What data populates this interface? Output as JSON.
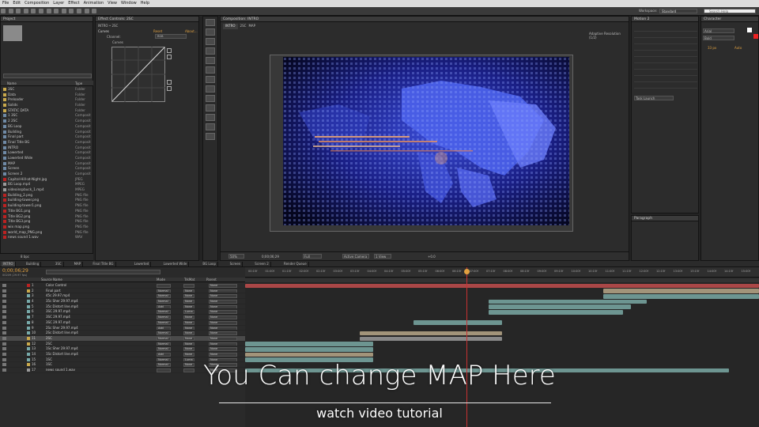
{
  "menu": [
    "File",
    "Edit",
    "Composition",
    "Layer",
    "Effect",
    "Animation",
    "View",
    "Window",
    "Help"
  ],
  "toolbar": {
    "workspace_label": "Workspace:",
    "workspace_value": "Standard",
    "search_placeholder": "Search Help"
  },
  "project": {
    "tab": "Project",
    "col_name": "Name",
    "col_type": "Type",
    "items": [
      {
        "name": "3SC",
        "type": "Folder",
        "kind": "folder"
      },
      {
        "name": "Data",
        "type": "Folder",
        "kind": "folder"
      },
      {
        "name": "Preloader",
        "type": "Folder",
        "kind": "folder"
      },
      {
        "name": "Solids",
        "type": "Folder",
        "kind": "folder"
      },
      {
        "name": "STATIC DATA",
        "type": "Folder",
        "kind": "folder"
      },
      {
        "name": "1 3SC",
        "type": "Composit",
        "kind": "comp"
      },
      {
        "name": "2 2SC",
        "type": "Composit",
        "kind": "comp"
      },
      {
        "name": "BG Loop",
        "type": "Composit",
        "kind": "comp"
      },
      {
        "name": "Building",
        "type": "Composit",
        "kind": "comp"
      },
      {
        "name": "Final part",
        "type": "Composit",
        "kind": "comp"
      },
      {
        "name": "Final Title BG",
        "type": "Composit",
        "kind": "comp"
      },
      {
        "name": "INTRO",
        "type": "Composit",
        "kind": "comp"
      },
      {
        "name": "Lowerted",
        "type": "Composit",
        "kind": "comp"
      },
      {
        "name": "Lowerted Wide",
        "type": "Composit",
        "kind": "comp"
      },
      {
        "name": "MAP",
        "type": "Composit",
        "kind": "comp"
      },
      {
        "name": "Screen",
        "type": "Composit",
        "kind": "comp"
      },
      {
        "name": "Screen 2",
        "type": "Composit",
        "kind": "comp"
      },
      {
        "name": "Capitol-Hill-at-Night.jpg",
        "type": "JPEG",
        "kind": "file"
      },
      {
        "name": "BG Loop.mp4",
        "type": "MPEG",
        "kind": "mp4"
      },
      {
        "name": "videoinspbuck_1.mp4",
        "type": "MPEG",
        "kind": "mp4"
      },
      {
        "name": "Building_2.png",
        "type": "PNG file",
        "kind": "file"
      },
      {
        "name": "building-tower.png",
        "type": "PNG file",
        "kind": "file"
      },
      {
        "name": "building-tower1.png",
        "type": "PNG file",
        "kind": "file"
      },
      {
        "name": "Title BG1.png",
        "type": "PNG file",
        "kind": "file"
      },
      {
        "name": "Title BG2.png",
        "type": "PNG file",
        "kind": "file"
      },
      {
        "name": "Title BG3.png",
        "type": "PNG file",
        "kind": "file"
      },
      {
        "name": "wix map.png",
        "type": "PNG file",
        "kind": "file"
      },
      {
        "name": "world_map_PNG.png",
        "type": "PNG file",
        "kind": "file"
      },
      {
        "name": "news sound 1.wav",
        "type": "WAV",
        "kind": "file"
      }
    ],
    "footer": "8 bpc"
  },
  "effect_controls": {
    "tab": "Effect Controls: 2SC",
    "breadcrumb": "INTRO • 2SC",
    "effect_name": "Curves",
    "reset": "Reset",
    "about": "About...",
    "channel_label": "Channel:",
    "channel_value": "RGB",
    "curves_label": "Curves"
  },
  "composition": {
    "tab": "Composition: INTRO",
    "crumbs": [
      "INTRO",
      "2SC",
      "MAP"
    ],
    "renderer": "Adaptive Resolution (1/2)",
    "zoom": "50%",
    "timecode": "0;00;06;29",
    "resolution": "Full",
    "camera": "Active Camera",
    "views": "1 View",
    "offset": "+0.0"
  },
  "right_panels": {
    "info_tab": "Info",
    "audio_tab": "Audio",
    "motion_tab": "Motion 2",
    "preset_tab": "Effects & Presets",
    "character_tab": "Character",
    "font": "Arial",
    "style": "Bold",
    "font_size": "33 px",
    "tracking": "Auto",
    "paragraph_tab": "Paragraph",
    "task_label": "Task Launch"
  },
  "timeline": {
    "tabs": [
      "INTRO",
      "Building",
      "3SC",
      "MAP",
      "Final Title BG",
      "Lowerted",
      "Lowerted Wide",
      "BG Loop",
      "Screen",
      "Screen 2",
      "Render Queue"
    ],
    "timecode": "0;00;06;29",
    "fps": "00209 (29.97 fps)",
    "col_source": "Source Name",
    "col_mode": "Mode",
    "col_trkmat": "TrkMat",
    "col_parent": "Parent",
    "ruler": [
      "00:15f",
      "01:00f",
      "01:15f",
      "02:00f",
      "02:15f",
      "03:00f",
      "03:15f",
      "04:00f",
      "04:15f",
      "05:00f",
      "05:15f",
      "06:00f",
      "06:15f",
      "07:00f",
      "07:15f",
      "08:00f",
      "08:15f",
      "09:00f",
      "09:15f",
      "10:00f",
      "10:15f",
      "11:00f",
      "11:15f",
      "12:00f",
      "12:15f",
      "13:00f",
      "13:15f",
      "14:00f",
      "14:15f",
      "15:00f"
    ],
    "layers": [
      {
        "num": "1",
        "name": "Color Control",
        "mode": "",
        "trk": "",
        "parent": "None",
        "color": "#b22"
      },
      {
        "num": "2",
        "name": "Final part",
        "mode": "Normal",
        "trk": "None",
        "parent": "None",
        "color": "#c9a94c"
      },
      {
        "num": "3",
        "name": "45c 29.97.mp4",
        "mode": "Normal",
        "trk": "None",
        "parent": "None",
        "color": "#7aa"
      },
      {
        "num": "4",
        "name": "35c Sher 29.97.mp4",
        "mode": "Normal",
        "trk": "None",
        "parent": "None",
        "color": "#7aa"
      },
      {
        "num": "5",
        "name": "35c Distort line.mp4",
        "mode": "Add",
        "trk": "None",
        "parent": "None",
        "color": "#7aa"
      },
      {
        "num": "6",
        "name": "3SC 29.97.mp4",
        "mode": "Normal",
        "trk": "Luma",
        "parent": "None",
        "color": "#7aa"
      },
      {
        "num": "7",
        "name": "3SC 29.97.mp4",
        "mode": "Normal",
        "trk": "None",
        "parent": "None",
        "color": "#7aa"
      },
      {
        "num": "8",
        "name": "3SC 29.97.mp4",
        "mode": "Normal",
        "trk": "None",
        "parent": "None",
        "color": "#7aa"
      },
      {
        "num": "9",
        "name": "2Sc Sher 29.97.mp4",
        "mode": "Add",
        "trk": "None",
        "parent": "None",
        "color": "#7aa"
      },
      {
        "num": "10",
        "name": "2Sc Distort line.mp4",
        "mode": "Normal",
        "trk": "None",
        "parent": "None",
        "color": "#7aa"
      },
      {
        "num": "11",
        "name": "2SC",
        "mode": "Normal",
        "trk": "None",
        "parent": "None",
        "color": "#c9a94c"
      },
      {
        "num": "12",
        "name": "2SC",
        "mode": "Normal",
        "trk": "None",
        "parent": "None",
        "color": "#c9a94c"
      },
      {
        "num": "13",
        "name": "1Sc Sher 29.97.mp4",
        "mode": "Normal",
        "trk": "None",
        "parent": "None",
        "color": "#7aa"
      },
      {
        "num": "14",
        "name": "1Sc Distort line.mp4",
        "mode": "Add",
        "trk": "None",
        "parent": "None",
        "color": "#7aa"
      },
      {
        "num": "15",
        "name": "1SC",
        "mode": "Normal",
        "trk": "Luma",
        "parent": "None",
        "color": "#7aa"
      },
      {
        "num": "16",
        "name": "1SC",
        "mode": "Normal",
        "trk": "None",
        "parent": "None",
        "color": "#c9a94c"
      },
      {
        "num": "17",
        "name": "news sound 1.wav",
        "mode": "",
        "trk": "",
        "parent": "None",
        "color": "#999"
      }
    ]
  },
  "overlay": {
    "title": "You Can change MAP Here",
    "subtitle": "watch video tutorial"
  },
  "colors": {
    "accent": "#e0a040",
    "playhead": "#c83232",
    "clip_teal": "#7aa9a4",
    "clip_tan": "#b8a88a",
    "clip_red": "#c24e4e"
  }
}
